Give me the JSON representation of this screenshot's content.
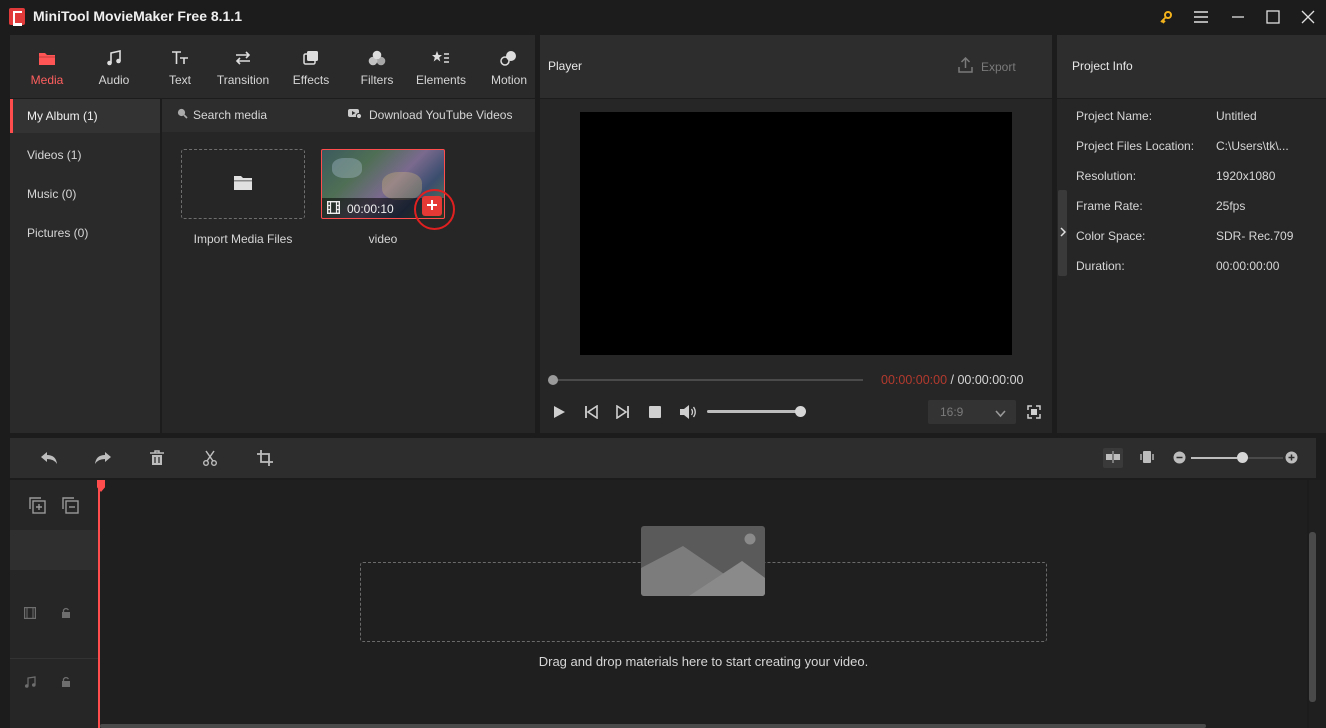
{
  "app": {
    "title": "MiniTool MovieMaker Free 8.1.1"
  },
  "window_controls": {
    "key_icon": "key-icon",
    "menu_icon": "hamburger-icon",
    "minimize_icon": "minimize-icon",
    "maximize_icon": "maximize-icon",
    "close_icon": "close-icon"
  },
  "toolbar": {
    "tabs": [
      {
        "label": "Media",
        "icon": "media-folder-icon",
        "active": true
      },
      {
        "label": "Audio",
        "icon": "music-note-icon",
        "active": false
      },
      {
        "label": "Text",
        "icon": "text-icon",
        "active": false
      },
      {
        "label": "Transition",
        "icon": "transition-arrows-icon",
        "active": false
      },
      {
        "label": "Effects",
        "icon": "effects-icon",
        "active": false
      },
      {
        "label": "Filters",
        "icon": "filters-icon",
        "active": false
      },
      {
        "label": "Elements",
        "icon": "elements-icon",
        "active": false
      },
      {
        "label": "Motion",
        "icon": "motion-icon",
        "active": false
      }
    ]
  },
  "sidebar": {
    "items": [
      {
        "label": "My Album (1)",
        "active": true
      },
      {
        "label": "Videos (1)",
        "active": false
      },
      {
        "label": "Music (0)",
        "active": false
      },
      {
        "label": "Pictures (0)",
        "active": false
      }
    ]
  },
  "media": {
    "search_label": "Search media",
    "download_label": "Download YouTube Videos",
    "import_label": "Import Media Files",
    "clip": {
      "name": "video",
      "duration": "00:00:10"
    }
  },
  "player": {
    "title": "Player",
    "export_label": "Export",
    "current_time": "00:00:00:00",
    "separator": " / ",
    "total_time": "00:00:00:00",
    "aspect_ratio": "16:9",
    "volume_level": 1.0,
    "progress": 0.0
  },
  "project_info": {
    "title": "Project Info",
    "rows": [
      {
        "label": "Project Name:",
        "value": "Untitled"
      },
      {
        "label": "Project Files Location:",
        "value": "C:\\Users\\tk\\..."
      },
      {
        "label": "Resolution:",
        "value": "1920x1080"
      },
      {
        "label": "Frame Rate:",
        "value": "25fps"
      },
      {
        "label": "Color Space:",
        "value": "SDR- Rec.709"
      },
      {
        "label": "Duration:",
        "value": "00:00:00:00"
      }
    ]
  },
  "timeline": {
    "drop_hint": "Drag and drop materials here to start creating your video.",
    "zoom_level": 0.5
  },
  "colors": {
    "accent": "#ff4d4d",
    "background": "#1c1c1c",
    "panel": "#262626",
    "time_current": "#c0392b"
  }
}
